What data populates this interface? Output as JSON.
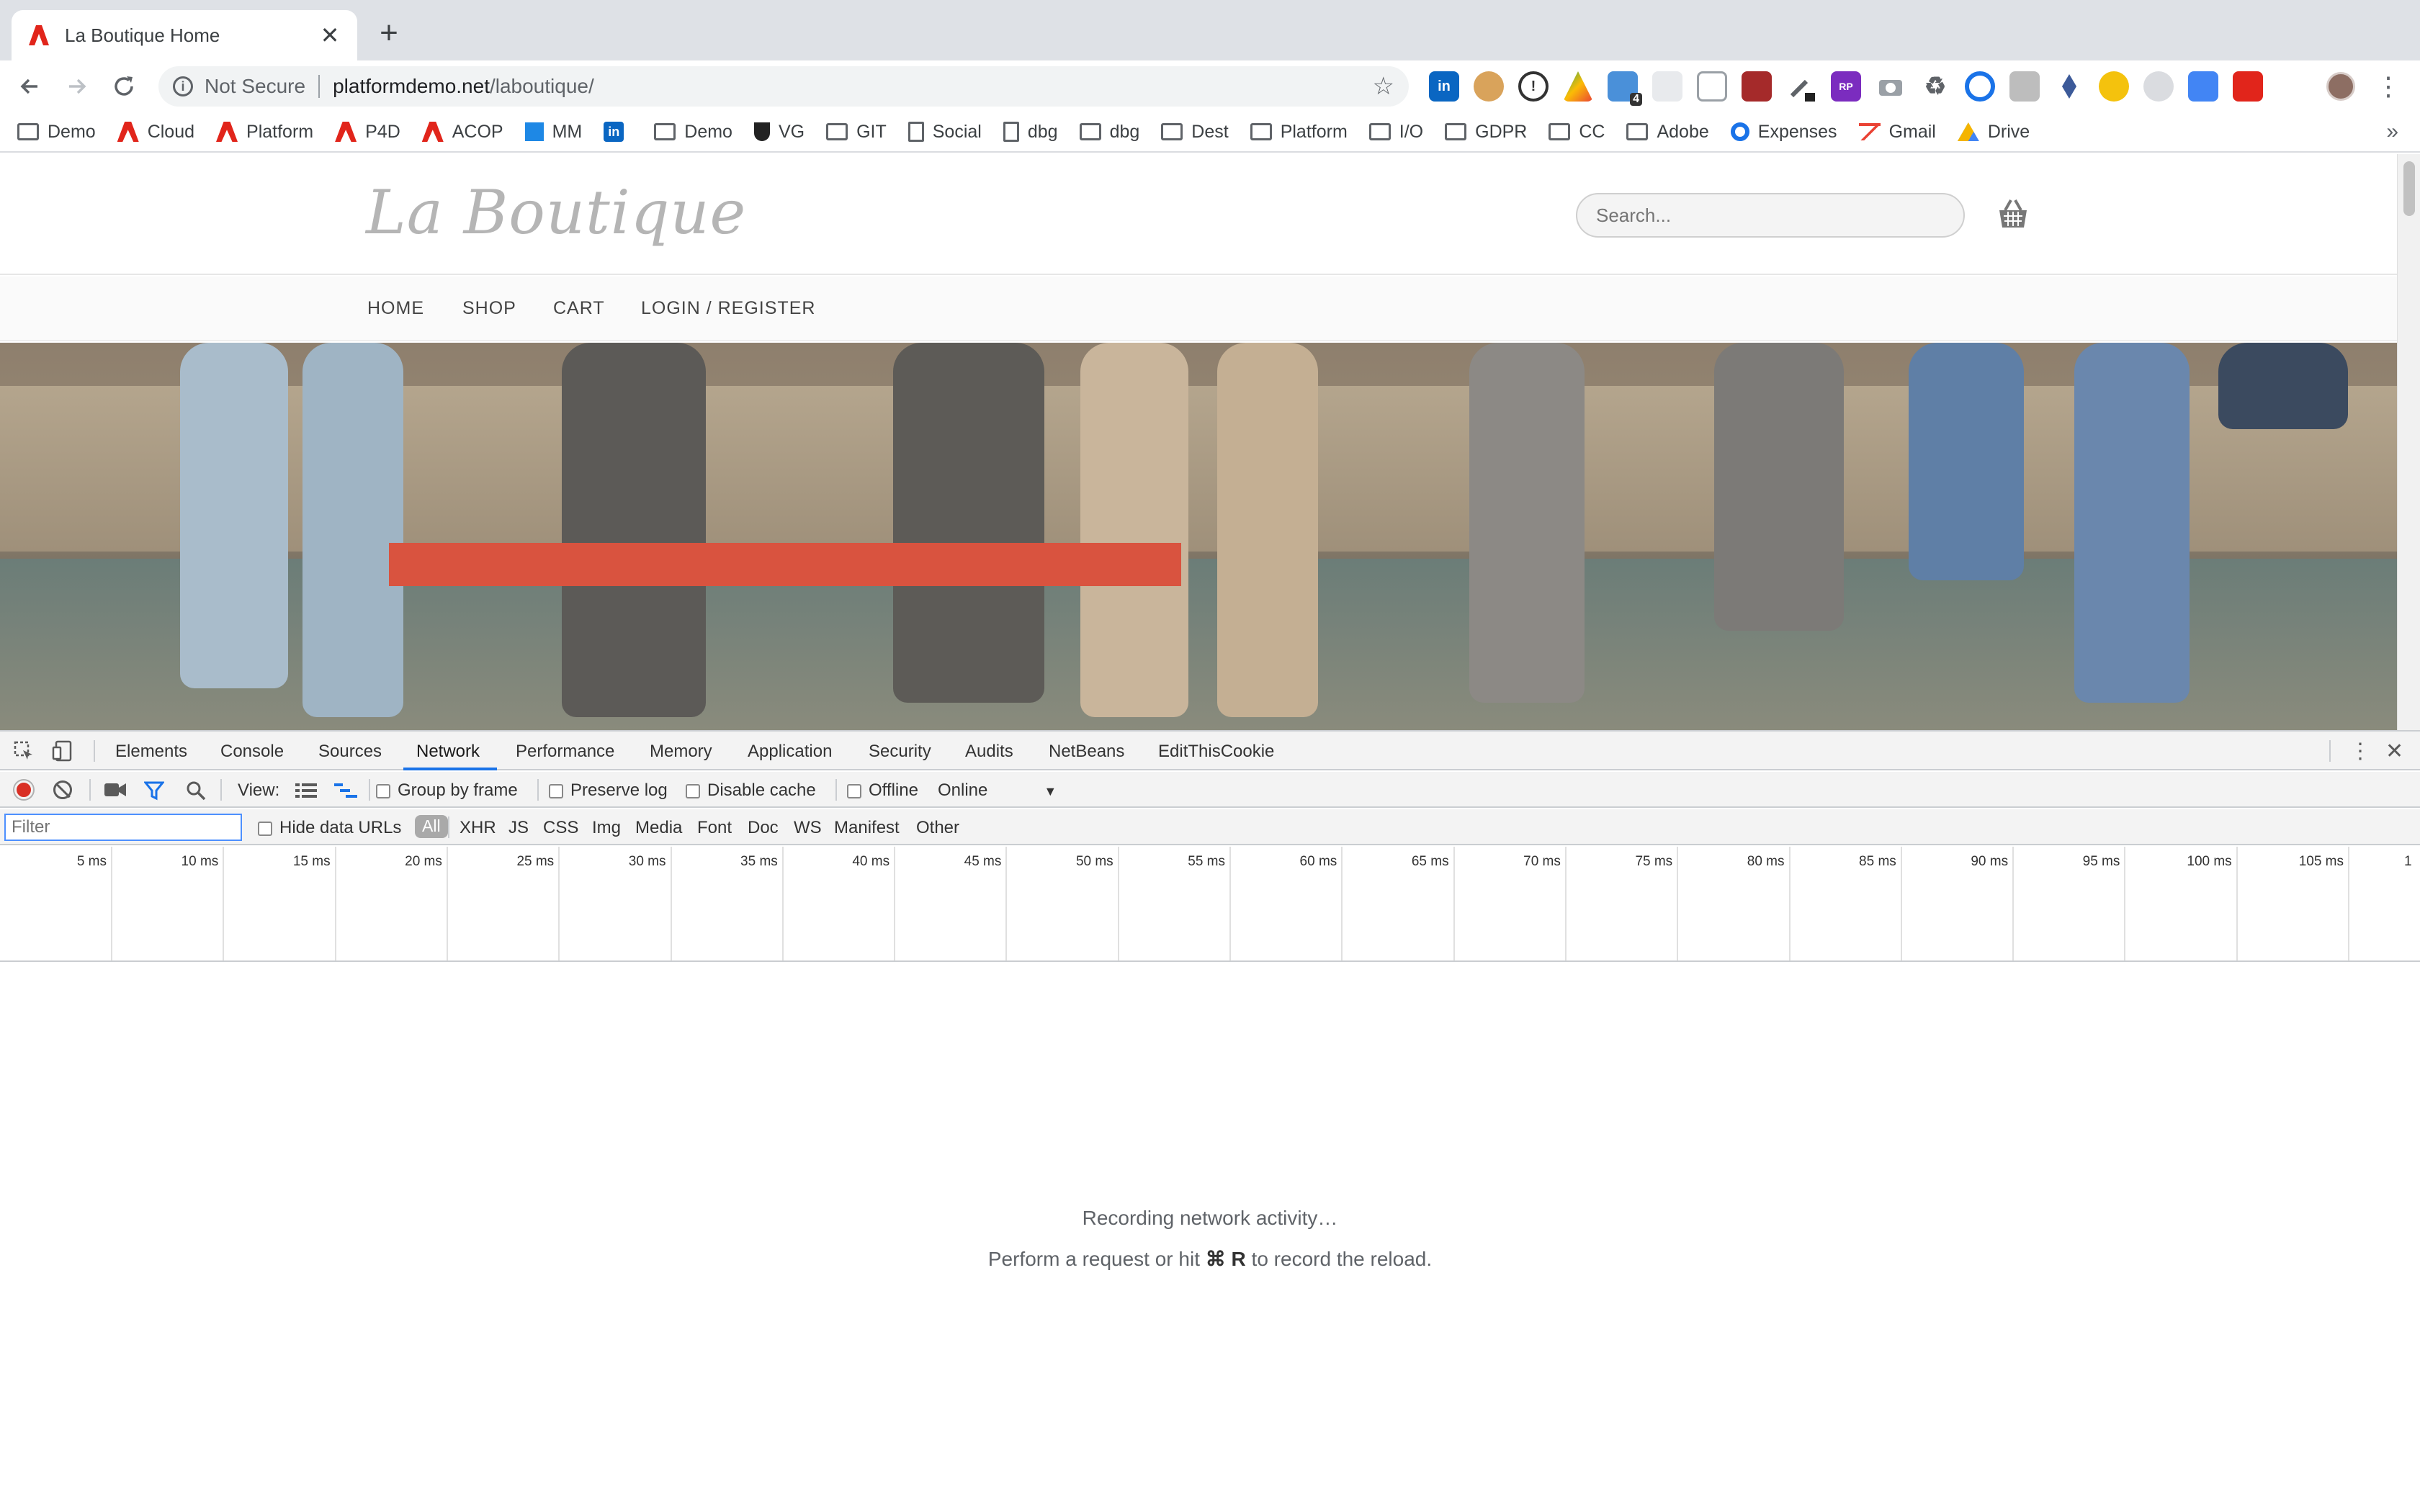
{
  "browser": {
    "tab_title": "La Boutique Home",
    "new_tab_symbol": "+",
    "close_symbol": "✕",
    "security_label": "Not Secure",
    "url_host": "platformdemo.net",
    "url_path": "/laboutique/",
    "extension_badge": "4",
    "extension_rp": "RP"
  },
  "bookmarks": [
    {
      "label": "Demo",
      "icon": "folder"
    },
    {
      "label": "Cloud",
      "icon": "adobe"
    },
    {
      "label": "Platform",
      "icon": "adobe"
    },
    {
      "label": "P4D",
      "icon": "adobe"
    },
    {
      "label": "ACOP",
      "icon": "adobe"
    },
    {
      "label": "MM",
      "icon": "chart"
    },
    {
      "label": "",
      "icon": "linkedin"
    },
    {
      "label": "Demo",
      "icon": "folder"
    },
    {
      "label": "VG",
      "icon": "shield"
    },
    {
      "label": "GIT",
      "icon": "folder"
    },
    {
      "label": "Social",
      "icon": "doc"
    },
    {
      "label": "dbg",
      "icon": "doc"
    },
    {
      "label": "dbg",
      "icon": "folder"
    },
    {
      "label": "Dest",
      "icon": "folder"
    },
    {
      "label": "Platform",
      "icon": "folder"
    },
    {
      "label": "I/O",
      "icon": "folder"
    },
    {
      "label": "GDPR",
      "icon": "folder"
    },
    {
      "label": "CC",
      "icon": "folder"
    },
    {
      "label": "Adobe",
      "icon": "folder"
    },
    {
      "label": "Expenses",
      "icon": "circle"
    },
    {
      "label": "Gmail",
      "icon": "gmail"
    },
    {
      "label": "Drive",
      "icon": "drive"
    }
  ],
  "bookmarks_overflow": "»",
  "site": {
    "logo": "La Boutique",
    "search_placeholder": "Search...",
    "nav": [
      "HOME",
      "SHOP",
      "CART",
      "LOGIN / REGISTER"
    ]
  },
  "devtools": {
    "tabs": [
      "Elements",
      "Console",
      "Sources",
      "Network",
      "Performance",
      "Memory",
      "Application",
      "Security",
      "Audits",
      "NetBeans",
      "EditThisCookie"
    ],
    "active_tab": "Network",
    "toolbar": {
      "view_label": "View:",
      "group_by_frame": "Group by frame",
      "preserve_log": "Preserve log",
      "disable_cache": "Disable cache",
      "offline": "Offline",
      "throttle": "Online"
    },
    "filter": {
      "placeholder": "Filter",
      "hide_data_urls": "Hide data URLs",
      "types": [
        "All",
        "XHR",
        "JS",
        "CSS",
        "Img",
        "Media",
        "Font",
        "Doc",
        "WS",
        "Manifest",
        "Other"
      ]
    },
    "timeline_ticks": [
      "5 ms",
      "10 ms",
      "15 ms",
      "20 ms",
      "25 ms",
      "30 ms",
      "35 ms",
      "40 ms",
      "45 ms",
      "50 ms",
      "55 ms",
      "60 ms",
      "65 ms",
      "70 ms",
      "75 ms",
      "80 ms",
      "85 ms",
      "90 ms",
      "95 ms",
      "100 ms",
      "105 ms",
      "1"
    ],
    "empty_line1": "Recording network activity…",
    "empty_line2_pre": "Perform a request or hit ",
    "empty_line2_key": "⌘ R",
    "empty_line2_post": " to record the reload."
  }
}
